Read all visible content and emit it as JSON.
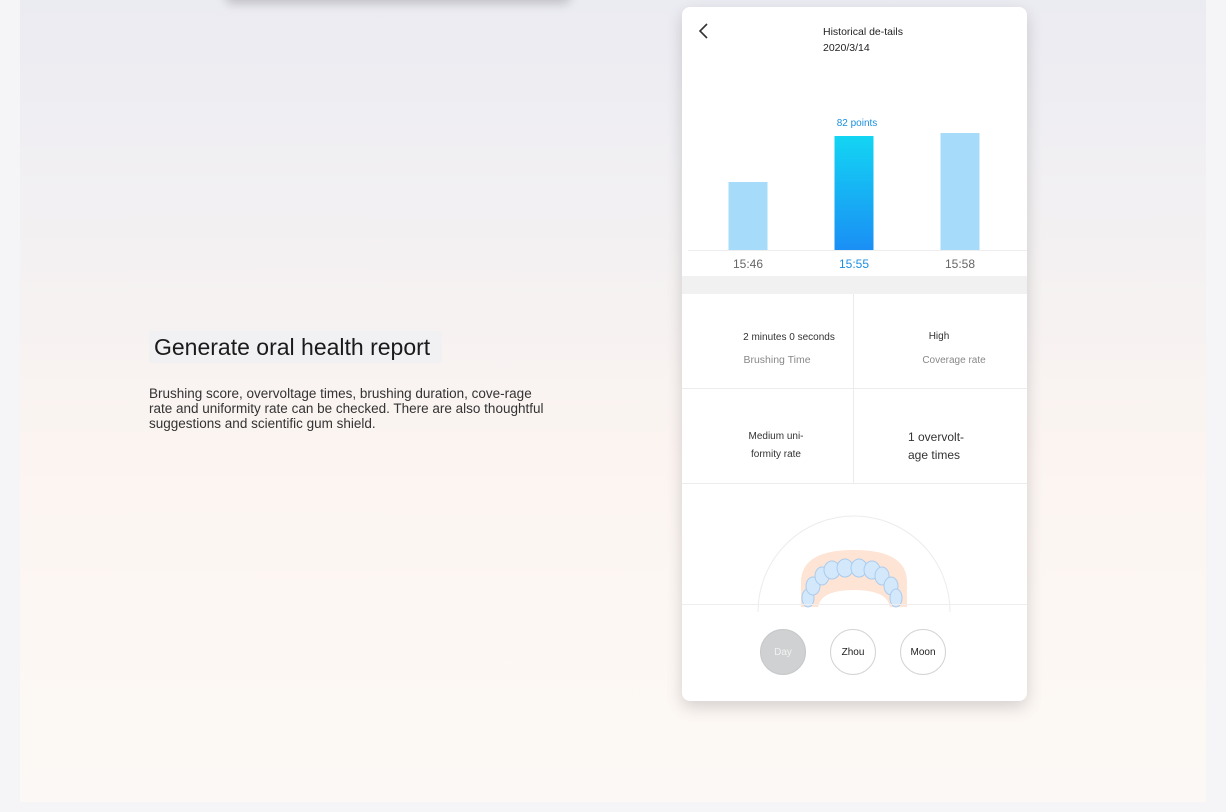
{
  "left_panel": {
    "headline": "Generate oral health report",
    "description": "Brushing score, overvoltage times, brushing duration, cove-rage rate and uniformity rate can be checked. There are also thoughtful suggestions and scientific gum shield."
  },
  "phone": {
    "title": "Historical de-tails 2020/3/14",
    "chart": {
      "highlight_label": "82 points",
      "bars": [
        {
          "time": "15:46",
          "value": 0.6,
          "active": false
        },
        {
          "time": "15:55",
          "value": 1.0,
          "active": true
        },
        {
          "time": "15:58",
          "value": 1.03,
          "active": false
        }
      ]
    },
    "stats": {
      "brushing_time_value": "2 minutes 0 seconds",
      "brushing_time_label": "Brushing Time",
      "coverage_value": "High",
      "coverage_label": "Coverage rate",
      "uniformity_line1": "Medium uni-",
      "uniformity_line2": "formity rate",
      "overvoltage_line1": "1 overvolt-",
      "overvoltage_line2": "age times"
    },
    "period_buttons": [
      {
        "label": "Day",
        "selected": true
      },
      {
        "label": "Zhou",
        "selected": false
      },
      {
        "label": "Moon",
        "selected": false
      }
    ]
  },
  "colors": {
    "accent_blue": "#1a8fe0",
    "bar_inactive": "#a6dcfa",
    "bar_active_top": "#13d5f3",
    "bar_active_bottom": "#1a8ff5"
  }
}
